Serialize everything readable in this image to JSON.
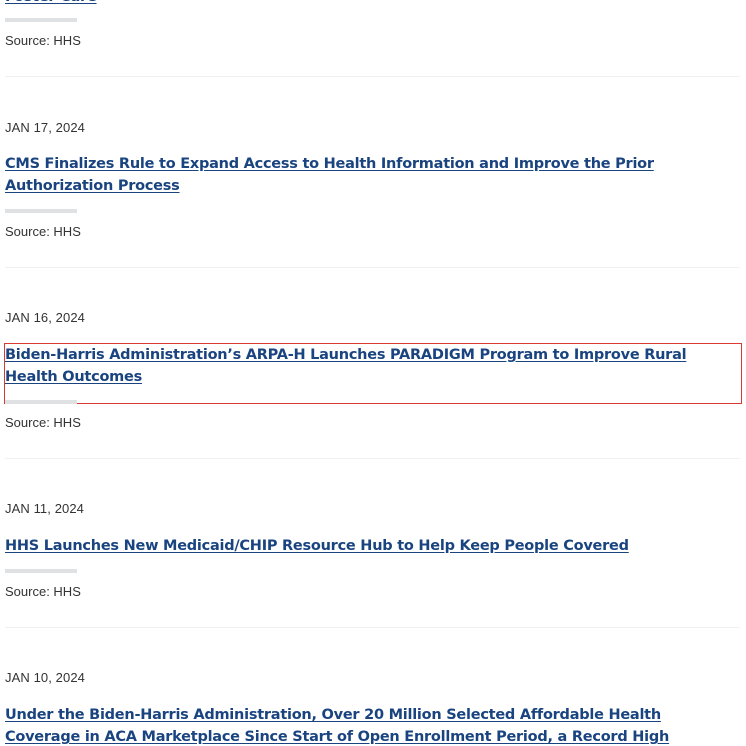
{
  "items": [
    {
      "date": "",
      "title": "Foster Care",
      "source": "Source: HHS"
    },
    {
      "date": "JAN 17, 2024",
      "title": "CMS Finalizes Rule to Expand Access to Health Information and Improve the Prior Authorization Process",
      "source": "Source: HHS"
    },
    {
      "date": "JAN 16, 2024",
      "title": "Biden-Harris Administration’s ARPA-H Launches PARADIGM Program to Improve Rural Health Outcomes",
      "source": "Source: HHS"
    },
    {
      "date": "JAN 11, 2024",
      "title": "HHS Launches New Medicaid/CHIP Resource Hub to Help Keep People Covered",
      "source": "Source: HHS"
    },
    {
      "date": "JAN 10, 2024",
      "title": "Under the Biden-Harris Administration, Over 20 Million Selected Affordable Health Coverage in ACA Marketplace Since Start of Open Enrollment Period, a Record High",
      "source": ""
    }
  ],
  "colors": {
    "link": "#1a4480",
    "highlight": "#d83933",
    "accent_bar": "#dfe1e2"
  }
}
